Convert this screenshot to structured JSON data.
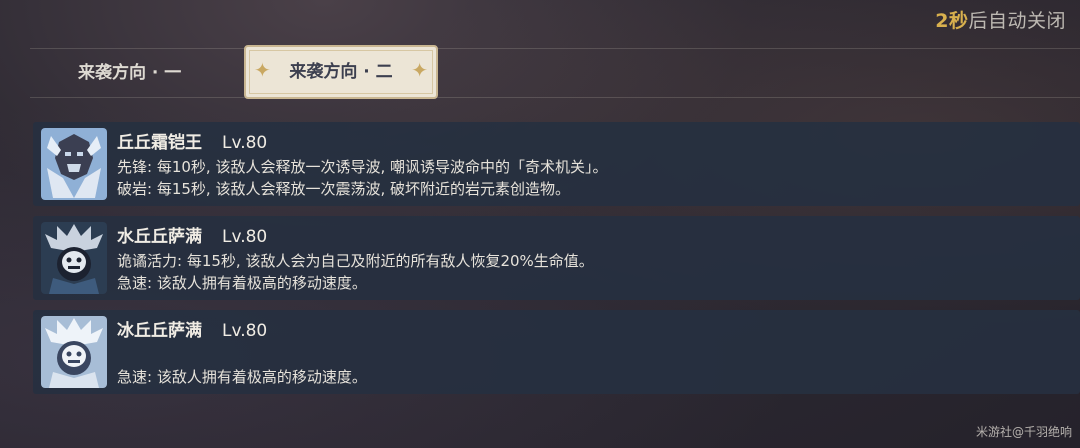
{
  "timer": {
    "count": "2秒",
    "suffix": "后自动关闭"
  },
  "tabs": [
    {
      "label": "来袭方向 · 一"
    },
    {
      "label": "来袭方向 · 二"
    }
  ],
  "enemies": [
    {
      "name": "丘丘霜铠王",
      "level": "Lv.80",
      "lines": [
        "先锋: 每10秒, 该敌人会释放一次诱导波, 嘲讽诱导波命中的「奇术机关」。",
        "破岩: 每15秒, 该敌人会释放一次震荡波, 破坏附近的岩元素创造物。"
      ],
      "icon": "frost-lawachurl-icon"
    },
    {
      "name": "水丘丘萨满",
      "level": "Lv.80",
      "lines": [
        "诡谲活力: 每15秒, 该敌人会为自己及附近的所有敌人恢复20%生命值。",
        "急速: 该敌人拥有着极高的移动速度。"
      ],
      "icon": "hydro-samachurl-icon"
    },
    {
      "name": "冰丘丘萨满",
      "level": "Lv.80",
      "lines": [
        "",
        "急速: 该敌人拥有着极高的移动速度。"
      ],
      "icon": "cryo-samachurl-icon"
    }
  ],
  "watermark": "米游社@千羽绝响",
  "colors": {
    "accent": "#d8b04e",
    "panel": "#263040",
    "tab_active_bg": "#ece5d6"
  }
}
